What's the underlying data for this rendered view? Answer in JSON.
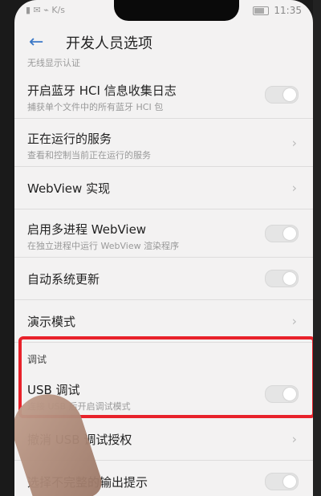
{
  "status": {
    "left": "▮ ✉ ⌁ K/s",
    "time": "11:35"
  },
  "header": {
    "title": "开发人员选项",
    "back_icon": "back-arrow"
  },
  "partial_top": "无线显示认证",
  "rows": [
    {
      "label": "开启蓝牙 HCI 信息收集日志",
      "sub": "捕获单个文件中的所有蓝牙 HCI 包",
      "control": "toggle"
    },
    {
      "label": "正在运行的服务",
      "sub": "查看和控制当前正在运行的服务",
      "control": "chevron"
    },
    {
      "label": "WebView 实现",
      "control": "chevron"
    },
    {
      "label": "启用多进程 WebView",
      "sub": "在独立进程中运行 WebView 渲染程序",
      "control": "toggle"
    },
    {
      "label": "自动系统更新",
      "control": "toggle"
    },
    {
      "label": "演示模式",
      "control": "chevron"
    }
  ],
  "section": {
    "title": "调试"
  },
  "usb_debug": {
    "label": "USB 调试",
    "sub": "连接 USB 后开启调试模式"
  },
  "revoke": {
    "label": "撤消 USB 调试授权"
  },
  "bottom_row": {
    "label": "选择不完整的输出提示"
  },
  "colors": {
    "highlight": "#e8222b",
    "accent": "#3b78c7"
  }
}
